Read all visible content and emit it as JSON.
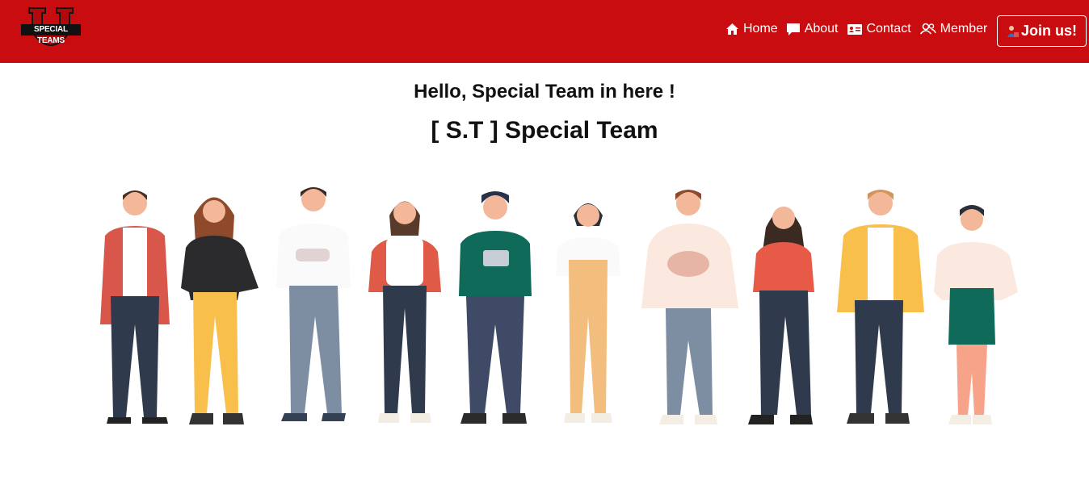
{
  "navbar": {
    "background": "#c90c0f",
    "logo": {
      "text": "SPECIAL TEAMS",
      "icon": "team-logo-shield"
    },
    "links": [
      {
        "label": "Home",
        "icon": "home-icon"
      },
      {
        "label": "About",
        "icon": "chat-icon"
      },
      {
        "label": "Contact",
        "icon": "contact-card-icon"
      },
      {
        "label": "Member",
        "icon": "users-icon"
      }
    ],
    "join_button": {
      "label": "Join us!",
      "icon": "person-icon"
    }
  },
  "hero": {
    "greeting": "Hello, Special Team in here !",
    "title": "[ S.T ] Special Team",
    "illustration": "group-of-ten-people-illustration"
  }
}
